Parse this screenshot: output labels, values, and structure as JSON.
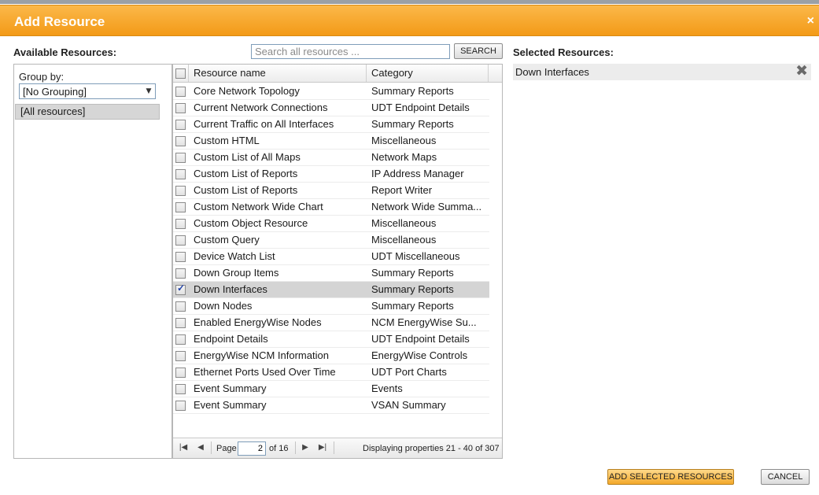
{
  "dialog": {
    "title": "Add Resource",
    "close_glyph": "×"
  },
  "available": {
    "heading": "Available Resources:",
    "search_placeholder": "Search all resources ...",
    "search_button": "SEARCH"
  },
  "group": {
    "label": "Group by:",
    "selected": "[No Grouping]",
    "all_resources": "[All resources]"
  },
  "grid": {
    "columns": [
      "Resource name",
      "Category"
    ],
    "rows": [
      {
        "name": "Core Network Topology",
        "category": "Summary Reports",
        "checked": false
      },
      {
        "name": "Current Network Connections",
        "category": "UDT Endpoint Details",
        "checked": false
      },
      {
        "name": "Current Traffic on All Interfaces",
        "category": "Summary Reports",
        "checked": false
      },
      {
        "name": "Custom HTML",
        "category": "Miscellaneous",
        "checked": false
      },
      {
        "name": "Custom List of All Maps",
        "category": "Network Maps",
        "checked": false
      },
      {
        "name": "Custom List of Reports",
        "category": "IP Address Manager",
        "checked": false
      },
      {
        "name": "Custom List of Reports",
        "category": "Report Writer",
        "checked": false
      },
      {
        "name": "Custom Network Wide Chart",
        "category": "Network Wide Summa...",
        "checked": false
      },
      {
        "name": "Custom Object Resource",
        "category": "Miscellaneous",
        "checked": false
      },
      {
        "name": "Custom Query",
        "category": "Miscellaneous",
        "checked": false
      },
      {
        "name": "Device Watch List",
        "category": "UDT Miscellaneous",
        "checked": false
      },
      {
        "name": "Down Group Items",
        "category": "Summary Reports",
        "checked": false
      },
      {
        "name": "Down Interfaces",
        "category": "Summary Reports",
        "checked": true
      },
      {
        "name": "Down Nodes",
        "category": "Summary Reports",
        "checked": false
      },
      {
        "name": "Enabled EnergyWise Nodes",
        "category": "NCM EnergyWise Su...",
        "checked": false
      },
      {
        "name": "Endpoint Details",
        "category": "UDT Endpoint Details",
        "checked": false
      },
      {
        "name": "EnergyWise NCM Information",
        "category": "EnergyWise Controls",
        "checked": false
      },
      {
        "name": "Ethernet Ports Used Over Time",
        "category": "UDT Port Charts",
        "checked": false
      },
      {
        "name": "Event Summary",
        "category": "Events",
        "checked": false
      },
      {
        "name": "Event Summary",
        "category": "VSAN Summary",
        "checked": false
      }
    ]
  },
  "pager": {
    "page_label": "Page",
    "page_value": "2",
    "of_text": "of 16",
    "display_text": "Displaying properties 21 - 40 of 307"
  },
  "selected": {
    "heading": "Selected Resources:",
    "items": [
      "Down Interfaces"
    ]
  },
  "actions": {
    "add_label": "ADD SELECTED RESOURCES",
    "cancel_label": "CANCEL"
  }
}
